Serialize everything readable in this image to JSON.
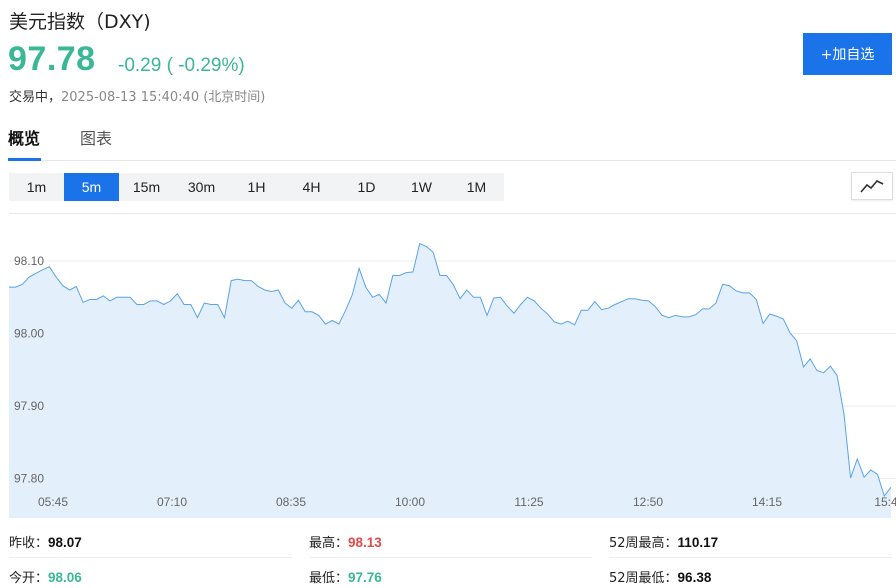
{
  "header": {
    "title": "美元指数（DXY)",
    "price": "97.78",
    "change": "-0.29 ( -0.29%)",
    "status_label": "交易中，",
    "timestamp": "2025-08-13 15:40:40 (北京时间)",
    "add_button_label": "+加自选"
  },
  "tabs": [
    {
      "label": "概览",
      "active": true
    },
    {
      "label": "图表",
      "active": false
    }
  ],
  "intervals": [
    {
      "label": "1m",
      "active": false
    },
    {
      "label": "5m",
      "active": true
    },
    {
      "label": "15m",
      "active": false
    },
    {
      "label": "30m",
      "active": false
    },
    {
      "label": "1H",
      "active": false
    },
    {
      "label": "4H",
      "active": false
    },
    {
      "label": "1D",
      "active": false
    },
    {
      "label": "1W",
      "active": false
    },
    {
      "label": "1M",
      "active": false
    }
  ],
  "icons": {
    "chart_type": "line-chart-icon"
  },
  "colors": {
    "up_down_green": "#3ab795",
    "high_red": "#e24a4a",
    "accent_blue": "#1a73e8",
    "line": "#5aa4e6",
    "fill": "#e3effb"
  },
  "stats": [
    {
      "label": "昨收：",
      "value": "98.07",
      "color": "#111111"
    },
    {
      "label": "最高：",
      "value": "98.13",
      "color": "#e24a4a"
    },
    {
      "label": "52周最高：",
      "value": "110.17",
      "color": "#111111"
    },
    {
      "label": "今开：",
      "value": "98.06",
      "color": "#3ab795"
    },
    {
      "label": "最低：",
      "value": "97.76",
      "color": "#3ab795"
    },
    {
      "label": "52周最低：",
      "value": "96.38",
      "color": "#111111"
    }
  ],
  "chart_data": {
    "type": "area",
    "y_ticks": [
      "98.10",
      "98.00",
      "97.90",
      "97.80"
    ],
    "x_ticks": [
      "05:45",
      "07:10",
      "08:35",
      "10:00",
      "11:25",
      "12:50",
      "14:15",
      "15:4"
    ],
    "ylim": [
      97.765,
      98.14
    ],
    "grid": true,
    "values": [
      98.064,
      98.064,
      98.068,
      98.078,
      98.083,
      98.088,
      98.092,
      98.078,
      98.066,
      98.06,
      98.065,
      98.043,
      98.047,
      98.047,
      98.052,
      98.045,
      98.05,
      98.05,
      98.05,
      98.04,
      98.04,
      98.045,
      98.045,
      98.04,
      98.045,
      98.055,
      98.04,
      98.04,
      98.022,
      98.042,
      98.04,
      98.04,
      98.022,
      98.073,
      98.075,
      98.073,
      98.073,
      98.065,
      98.06,
      98.058,
      98.06,
      98.042,
      98.035,
      98.046,
      98.03,
      98.03,
      98.025,
      98.013,
      98.018,
      98.013,
      98.032,
      98.054,
      98.09,
      98.064,
      98.05,
      98.054,
      98.042,
      98.08,
      98.08,
      98.084,
      98.085,
      98.124,
      98.12,
      98.112,
      98.08,
      98.08,
      98.067,
      98.048,
      98.06,
      98.05,
      98.05,
      98.025,
      98.049,
      98.05,
      98.038,
      98.028,
      98.04,
      98.05,
      98.045,
      98.035,
      98.027,
      98.016,
      98.013,
      98.017,
      98.012,
      98.032,
      98.032,
      98.044,
      98.033,
      98.035,
      98.04,
      98.044,
      98.048,
      98.048,
      98.046,
      98.045,
      98.037,
      98.025,
      98.022,
      98.025,
      98.023,
      98.023,
      98.026,
      98.034,
      98.034,
      98.042,
      98.068,
      98.066,
      98.059,
      98.056,
      98.056,
      98.047,
      98.014,
      98.027,
      98.024,
      98.02,
      98.001,
      97.99,
      97.954,
      97.965,
      97.949,
      97.946,
      97.955,
      97.942,
      97.89,
      97.801,
      97.827,
      97.802,
      97.812,
      97.806,
      97.776,
      97.788
    ]
  }
}
